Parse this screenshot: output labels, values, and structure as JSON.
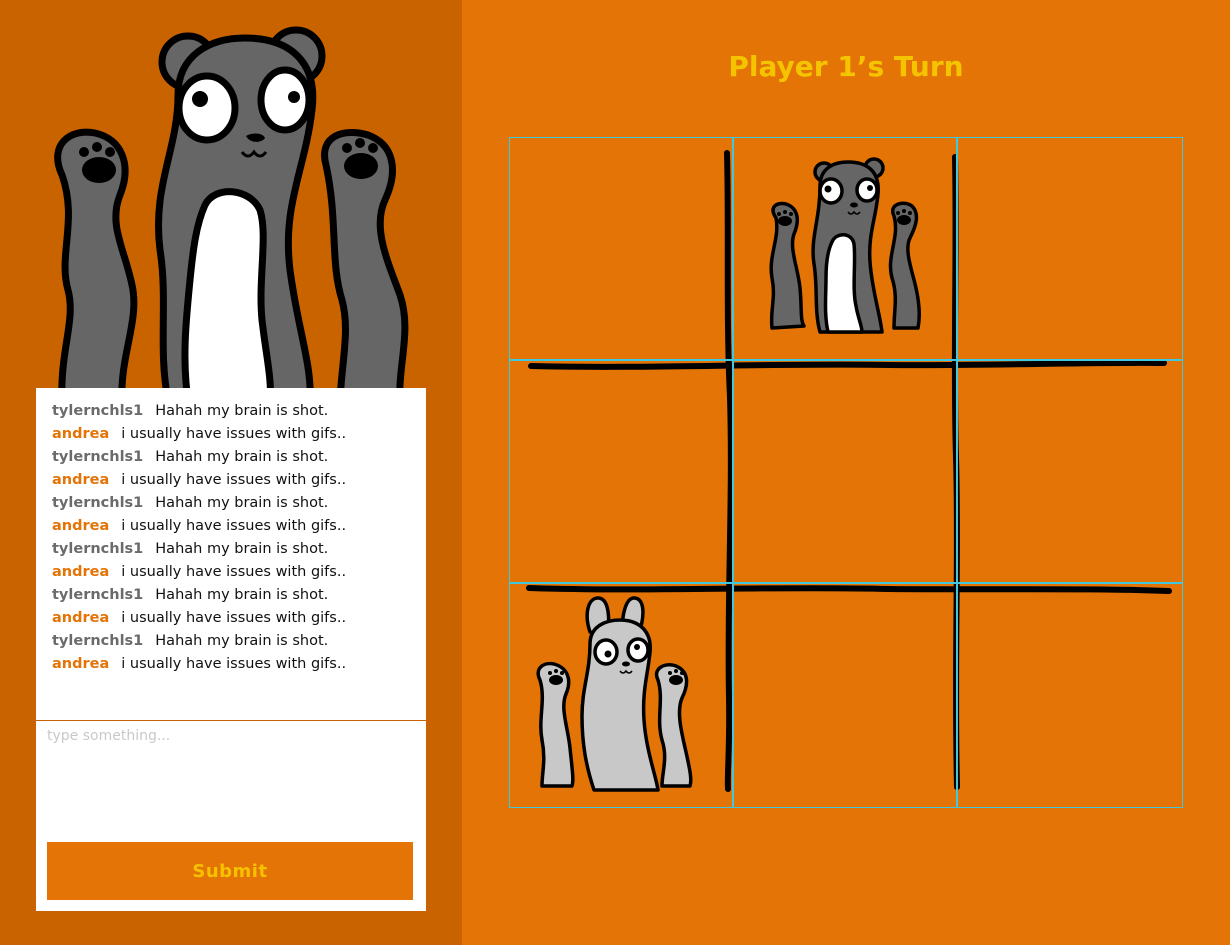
{
  "chat": {
    "messages": [
      {
        "user": "tylernchls1",
        "text": "Hahah my brain is shot.",
        "user_color": "#6b6b6b"
      },
      {
        "user": "andrea",
        "text": "i usually have issues with gifs..",
        "user_color": "#e37405"
      },
      {
        "user": "tylernchls1",
        "text": "Hahah my brain is shot.",
        "user_color": "#6b6b6b"
      },
      {
        "user": "andrea",
        "text": "i usually have issues with gifs..",
        "user_color": "#e37405"
      },
      {
        "user": "tylernchls1",
        "text": "Hahah my brain is shot.",
        "user_color": "#6b6b6b"
      },
      {
        "user": "andrea",
        "text": "i usually have issues with gifs..",
        "user_color": "#e37405"
      },
      {
        "user": "tylernchls1",
        "text": "Hahah my brain is shot.",
        "user_color": "#6b6b6b"
      },
      {
        "user": "andrea",
        "text": "i usually have issues with gifs..",
        "user_color": "#e37405"
      },
      {
        "user": "tylernchls1",
        "text": "Hahah my brain is shot.",
        "user_color": "#6b6b6b"
      },
      {
        "user": "andrea",
        "text": "i usually have issues with gifs..",
        "user_color": "#e37405"
      },
      {
        "user": "tylernchls1",
        "text": "Hahah my brain is shot.",
        "user_color": "#6b6b6b"
      },
      {
        "user": "andrea",
        "text": "i usually have issues with gifs..",
        "user_color": "#e37405"
      }
    ],
    "input_placeholder": "type something...",
    "input_value": "",
    "submit_label": "Submit"
  },
  "game": {
    "turn_label": "Player 1’s Turn",
    "board": [
      [
        "",
        "bear",
        ""
      ],
      [
        "",
        "",
        ""
      ],
      [
        "bunny",
        "",
        ""
      ]
    ]
  },
  "colors": {
    "sidebar_bg": "#c96300",
    "main_bg": "#e37405",
    "accent_yellow": "#f5c400",
    "grid_line": "#40c8e0",
    "bear_gray": "#666666",
    "bunny_gray": "#c8c8c8"
  },
  "icons": {
    "mascot": "bear-mascot-icon",
    "bear_piece": "bear-piece-icon",
    "bunny_piece": "bunny-piece-icon"
  }
}
